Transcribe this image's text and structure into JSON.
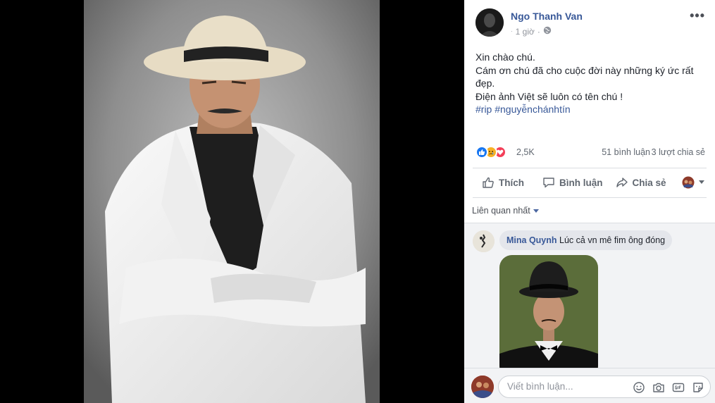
{
  "post": {
    "author": "Ngo Thanh Van",
    "time": "1 giờ",
    "text_lines": [
      "Xin chào chú.",
      "Cám ơn chú đã cho cuộc đời này những ký ức rất đẹp.",
      "Điện ảnh Việt sẽ luôn có tên chú !"
    ],
    "hashtags": "#rip #nguyễnchánhtín"
  },
  "stats": {
    "reactions": "2,5K",
    "comments": "51 bình luận",
    "shares": "3 lượt chia sẻ"
  },
  "actions": {
    "like": "Thích",
    "comment": "Bình luận",
    "share": "Chia sẻ"
  },
  "sort": {
    "label": "Liên quan nhất"
  },
  "comment": {
    "name": "Mina Quynh",
    "text": "Lúc cả vn mê fim ông đóng"
  },
  "composer": {
    "placeholder": "Viết bình luận..."
  },
  "icons": {
    "privacy": "globe-icon",
    "more": "more-icon",
    "like": "thumbs-up-icon",
    "comment": "comment-bubble-icon",
    "share": "share-arrow-icon",
    "camera": "camera-icon",
    "emoji": "emoji-icon",
    "gif": "gif-icon",
    "sticker": "sticker-icon"
  },
  "colors": {
    "link": "#385898",
    "like_blue": "#1877f2",
    "love_red": "#f33e58",
    "sad_yellow": "#f7b125"
  }
}
